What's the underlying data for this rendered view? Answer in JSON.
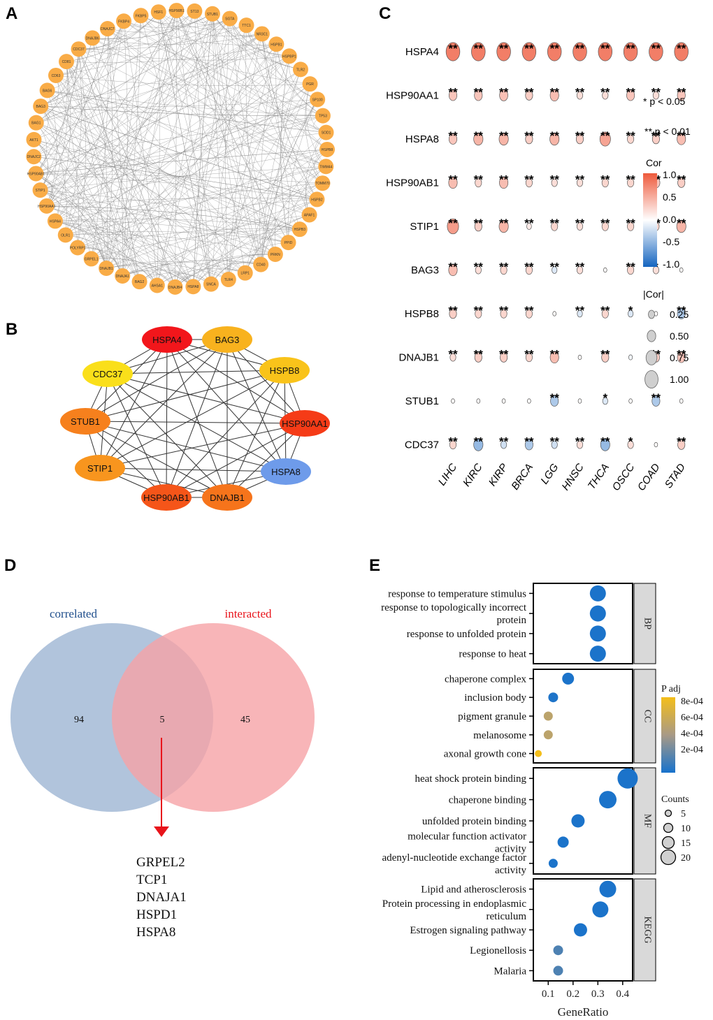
{
  "panels": {
    "A": {
      "letter": "A"
    },
    "B": {
      "letter": "B"
    },
    "C": {
      "letter": "C"
    },
    "D": {
      "letter": "D"
    },
    "E": {
      "letter": "E"
    }
  },
  "chart_data": [
    {
      "id": "A",
      "type": "network",
      "layout": "circle",
      "node_color": "#F9AC47",
      "edge_color": "#8a8a8a",
      "nodes": [
        "HSF1",
        "HSP90B1",
        "ST13",
        "STUB1",
        "SGTA",
        "TTC1",
        "NR3C1",
        "HSPB1",
        "HSPBP1",
        "TLR2",
        "PGR",
        "SP100",
        "TP53",
        "SOD1",
        "HSPB8",
        "TIMM44",
        "TOMM70",
        "HSPB2",
        "APAF1",
        "HSPB3",
        "PPID",
        "PRKN",
        "CD40",
        "LRP1",
        "TLR4",
        "SNCA",
        "HSPA8",
        "DNAJB4",
        "AHSA1",
        "BAG2",
        "DNAJA1",
        "DNAJB1",
        "GRPEL1",
        "POLYRP1",
        "OLR1",
        "HSPA4",
        "HSP90AA1",
        "STIP1",
        "HSP90AB1",
        "DNAJC2",
        "AKT1",
        "BAG1",
        "BAG3",
        "BAG6",
        "CD63",
        "CD81",
        "CDC37",
        "DNAJB6",
        "DNAJC7",
        "FKBP4",
        "FKBP5"
      ]
    },
    {
      "id": "B",
      "type": "network",
      "layout": "circle",
      "edge_color": "#333333",
      "nodes": [
        {
          "name": "HSPA4",
          "color": "#F2161B"
        },
        {
          "name": "BAG3",
          "color": "#F8B21E"
        },
        {
          "name": "HSPB8",
          "color": "#F9C31A"
        },
        {
          "name": "HSP90AA1",
          "color": "#F53B17"
        },
        {
          "name": "HSPA8",
          "color": "#6E9BEA"
        },
        {
          "name": "DNAJB1",
          "color": "#F6741B"
        },
        {
          "name": "HSP90AB1",
          "color": "#F55519"
        },
        {
          "name": "STIP1",
          "color": "#F8951E"
        },
        {
          "name": "STUB1",
          "color": "#F6801D"
        },
        {
          "name": "CDC37",
          "color": "#FADF1A"
        }
      ],
      "edges": "complete"
    },
    {
      "id": "C",
      "type": "heatmap",
      "title": "",
      "rows": [
        "HSPA4",
        "HSP90AA1",
        "HSPA8",
        "HSP90AB1",
        "STIP1",
        "BAG3",
        "HSPB8",
        "DNAJB1",
        "STUB1",
        "CDC37"
      ],
      "columns": [
        "LIHC",
        "KIRC",
        "KIRP",
        "BRCA",
        "LGG",
        "HNSC",
        "THCA",
        "OSCC",
        "COAD",
        "STAD"
      ],
      "cor": [
        [
          0.78,
          0.78,
          0.78,
          0.78,
          0.78,
          0.78,
          0.78,
          0.78,
          0.78,
          0.78
        ],
        [
          0.35,
          0.35,
          0.38,
          0.3,
          0.4,
          0.2,
          0.2,
          0.35,
          0.2,
          0.35
        ],
        [
          0.35,
          0.45,
          0.45,
          0.3,
          0.45,
          0.3,
          0.55,
          0.25,
          0.3,
          0.4
        ],
        [
          0.4,
          0.25,
          0.4,
          0.25,
          0.2,
          0.2,
          0.25,
          0.25,
          0.35,
          0.3
        ],
        [
          0.6,
          0.3,
          0.45,
          0.12,
          0.25,
          0.2,
          0.25,
          0.25,
          0.25,
          0.45
        ],
        [
          0.4,
          0.2,
          0.25,
          0.25,
          -0.15,
          0.2,
          0.02,
          0.25,
          0.2,
          0.02
        ],
        [
          0.3,
          0.25,
          0.25,
          0.25,
          0.02,
          -0.15,
          0.25,
          -0.15,
          0.02,
          -0.35
        ],
        [
          0.2,
          0.3,
          0.3,
          0.25,
          0.4,
          0.02,
          0.3,
          -0.05,
          0.3,
          0.35
        ],
        [
          0.02,
          0.02,
          0.02,
          0.02,
          -0.35,
          0.02,
          -0.15,
          0.02,
          -0.35,
          0.02
        ],
        [
          0.25,
          -0.45,
          -0.2,
          -0.35,
          -0.2,
          0.2,
          -0.45,
          0.2,
          0.02,
          0.3
        ]
      ],
      "significance": [
        [
          "**",
          "**",
          "**",
          "**",
          "**",
          "**",
          "**",
          "**",
          "**",
          "**"
        ],
        [
          "**",
          "**",
          "**",
          "**",
          "**",
          "**",
          "**",
          "**",
          "**",
          "**"
        ],
        [
          "**",
          "**",
          "**",
          "**",
          "**",
          "**",
          "**",
          "**",
          "**",
          "**"
        ],
        [
          "**",
          "**",
          "**",
          "**",
          "**",
          "**",
          "**",
          "**",
          "**",
          "**"
        ],
        [
          "**",
          "**",
          "**",
          "**",
          "**",
          "**",
          "**",
          "**",
          "**",
          "**"
        ],
        [
          "**",
          "**",
          "**",
          "**",
          "**",
          "**",
          "",
          "**",
          "*",
          ""
        ],
        [
          "**",
          "**",
          "**",
          "**",
          "",
          "**",
          "**",
          "*",
          "",
          "**"
        ],
        [
          "**",
          "**",
          "**",
          "**",
          "**",
          "",
          "**",
          "",
          "**",
          "**"
        ],
        [
          "",
          "",
          "",
          "",
          "**",
          "",
          "*",
          "",
          "**",
          ""
        ],
        [
          "**",
          "**",
          "**",
          "**",
          "**",
          "**",
          "**",
          "*",
          "",
          "**"
        ]
      ],
      "sig_legend": [
        "* p < 0.05",
        "** p < 0.01"
      ],
      "color_legend": {
        "title": "Cor",
        "ticks": [
          "1.0",
          "0.5",
          "0.0",
          "-0.5",
          "-1.0"
        ],
        "low": "#1565C0",
        "mid": "#FFFFFF",
        "high": "#EE5A3C"
      },
      "size_legend": {
        "title": "|Cor|",
        "ticks": [
          "0.25",
          "0.50",
          "0.75",
          "1.00"
        ]
      }
    },
    {
      "id": "D",
      "type": "venn",
      "sets": [
        {
          "name": "correlated",
          "only": 94,
          "color": "#A3BAD6",
          "label_color": "#1F4E8C"
        },
        {
          "name": "interacted",
          "only": 45,
          "color": "#F6A3A6",
          "label_color": "#E8141B"
        }
      ],
      "intersection": 5,
      "intersection_genes": [
        "GRPEL2",
        "TCP1",
        "DNAJA1",
        "HSPD1",
        "HSPA8"
      ],
      "arrow_color": "#E8141B"
    },
    {
      "id": "E",
      "type": "scatter",
      "xlabel": "GeneRatio",
      "xticks": [
        "0.1",
        "0.2",
        "0.3",
        "0.4"
      ],
      "xlim": [
        0.04,
        0.44
      ],
      "facets": [
        {
          "name": "BP",
          "terms": [
            {
              "label": [
                "response to temperature stimulus"
              ],
              "x": 0.3,
              "count": 16,
              "padj": 1e-05
            },
            {
              "label": [
                "response to topologically incorrect",
                "protein"
              ],
              "x": 0.3,
              "count": 16,
              "padj": 1e-05
            },
            {
              "label": [
                "response to unfolded protein"
              ],
              "x": 0.3,
              "count": 16,
              "padj": 1e-05
            },
            {
              "label": [
                "response to heat"
              ],
              "x": 0.3,
              "count": 16,
              "padj": 1e-05
            }
          ]
        },
        {
          "name": "CC",
          "terms": [
            {
              "label": [
                "chaperone complex"
              ],
              "x": 0.18,
              "count": 10,
              "padj": 1e-05
            },
            {
              "label": [
                "inclusion body"
              ],
              "x": 0.12,
              "count": 7,
              "padj": 2e-05
            },
            {
              "label": [
                "pigment granule"
              ],
              "x": 0.1,
              "count": 6,
              "padj": 0.0005
            },
            {
              "label": [
                "melanosome"
              ],
              "x": 0.1,
              "count": 6,
              "padj": 0.0005
            },
            {
              "label": [
                "axonal growth cone"
              ],
              "x": 0.06,
              "count": 3,
              "padj": 0.0008
            }
          ]
        },
        {
          "name": "MF",
          "terms": [
            {
              "label": [
                "heat shock protein binding"
              ],
              "x": 0.42,
              "count": 22,
              "padj": 1e-05
            },
            {
              "label": [
                "chaperone binding"
              ],
              "x": 0.34,
              "count": 18,
              "padj": 1e-05
            },
            {
              "label": [
                "unfolded protein binding"
              ],
              "x": 0.22,
              "count": 12,
              "padj": 1e-05
            },
            {
              "label": [
                "molecular function activator",
                "activity"
              ],
              "x": 0.16,
              "count": 9,
              "padj": 1e-05
            },
            {
              "label": [
                "adenyl-nucleotide exchange factor",
                "activity"
              ],
              "x": 0.12,
              "count": 6,
              "padj": 1e-05
            }
          ]
        },
        {
          "name": "KEGG",
          "terms": [
            {
              "label": [
                "Lipid and atherosclerosis"
              ],
              "x": 0.34,
              "count": 17,
              "padj": 1e-05
            },
            {
              "label": [
                "Protein processing in endoplasmic",
                "reticulum"
              ],
              "x": 0.31,
              "count": 16,
              "padj": 1e-05
            },
            {
              "label": [
                "Estrogen signaling pathway"
              ],
              "x": 0.23,
              "count": 12,
              "padj": 1e-05
            },
            {
              "label": [
                "Legionellosis"
              ],
              "x": 0.14,
              "count": 7,
              "padj": 0.00015
            },
            {
              "label": [
                "Malaria"
              ],
              "x": 0.14,
              "count": 7,
              "padj": 0.00015
            }
          ]
        }
      ],
      "color_legend": {
        "title": "P adj",
        "ticks": [
          "8e-04",
          "6e-04",
          "4e-04",
          "2e-04"
        ],
        "low": "#1772CC",
        "mid": "#A89A86",
        "high": "#F4BE1A"
      },
      "size_legend": {
        "title": "Counts",
        "ticks": [
          "5",
          "10",
          "15",
          "20"
        ]
      }
    }
  ]
}
